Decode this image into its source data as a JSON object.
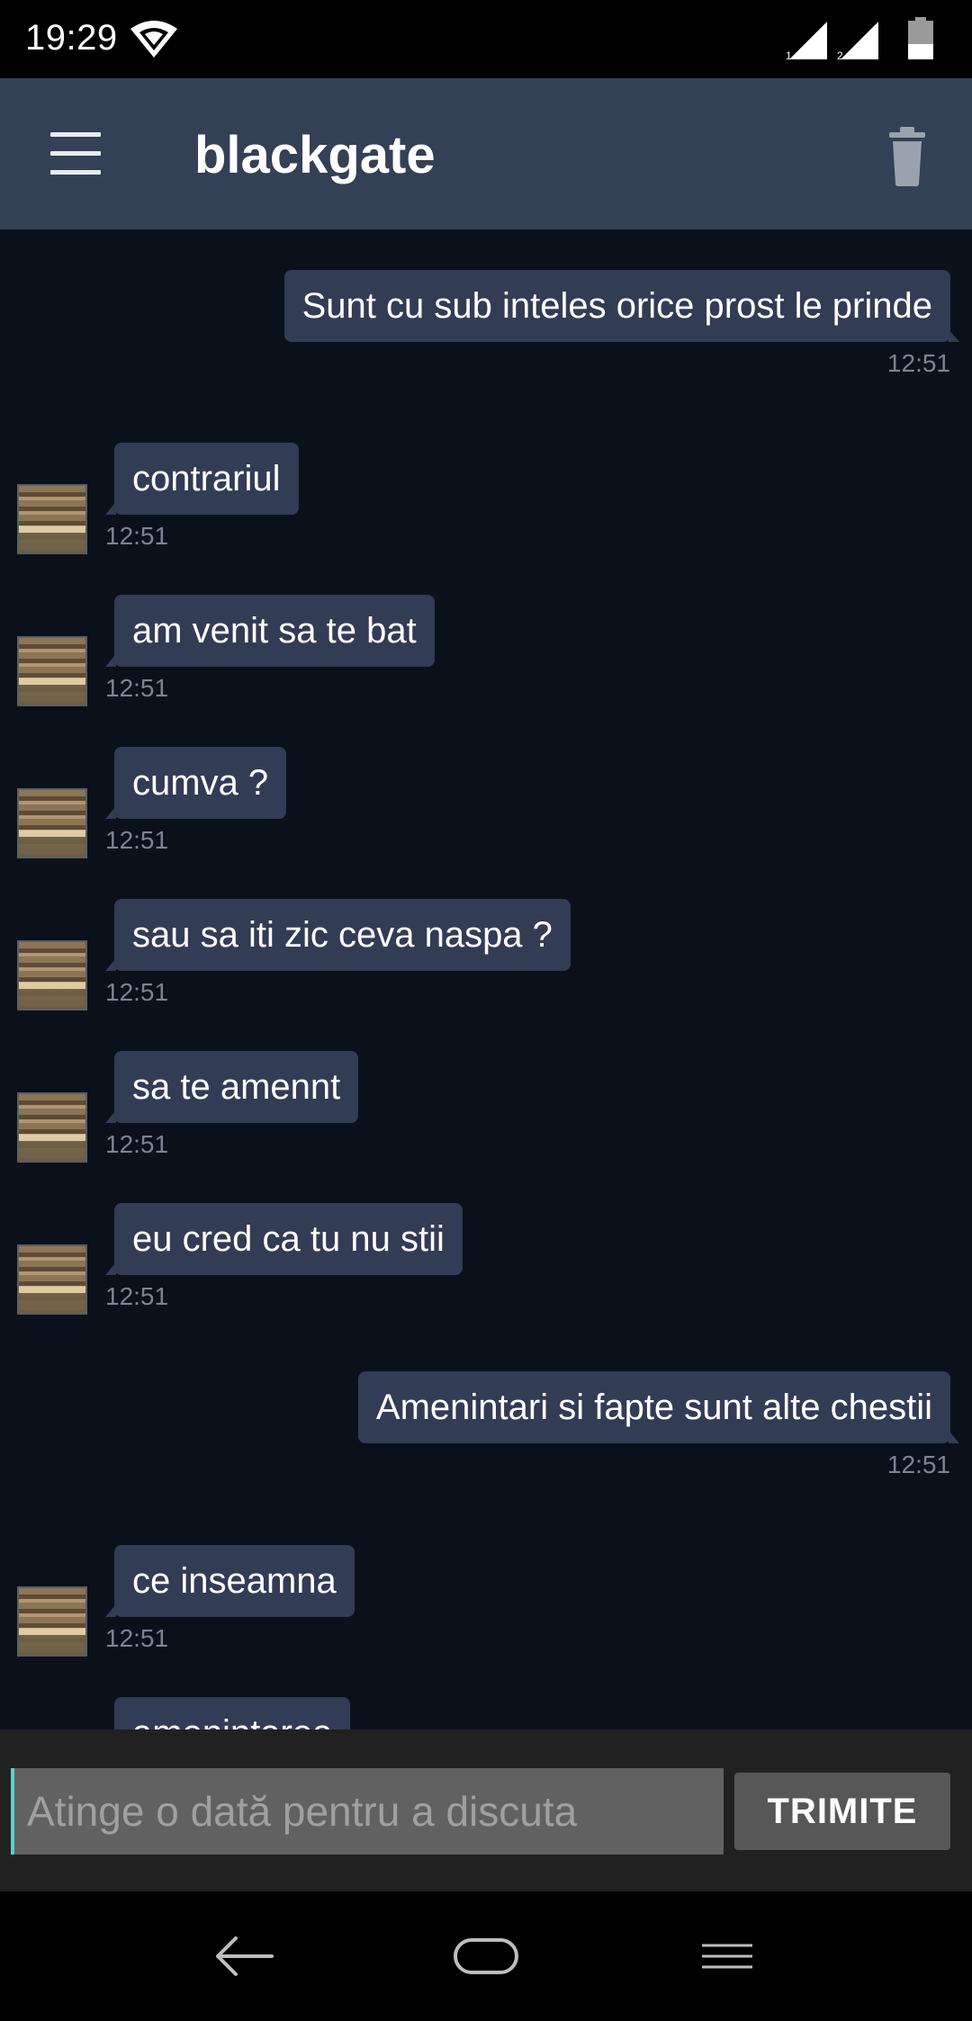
{
  "status_bar": {
    "time": "19:29",
    "icons": [
      "wifi-icon",
      "signal-sim1-icon",
      "signal-sim2-icon",
      "battery-icon"
    ],
    "sim1_label": "1",
    "sim2_label": "2"
  },
  "app_bar": {
    "title": "blackgate",
    "menu_icon": "menu-icon",
    "delete_icon": "trash-icon"
  },
  "messages": [
    {
      "direction": "out",
      "text": "Sunt cu sub inteles orice prost le prinde",
      "time": "12:51"
    },
    {
      "direction": "in",
      "text": "contrariul",
      "time": "12:51"
    },
    {
      "direction": "in",
      "text": "am venit sa te bat",
      "time": "12:51"
    },
    {
      "direction": "in",
      "text": "cumva ?",
      "time": "12:51"
    },
    {
      "direction": "in",
      "text": "sau sa iti zic ceva naspa ?",
      "time": "12:51"
    },
    {
      "direction": "in",
      "text": "sa te amennt",
      "time": "12:51"
    },
    {
      "direction": "in",
      "text": "eu cred ca tu nu stii",
      "time": "12:51"
    },
    {
      "direction": "out",
      "text": "Amenintari si fapte sunt alte chestii",
      "time": "12:51"
    },
    {
      "direction": "in",
      "text": "ce inseamna",
      "time": "12:51"
    },
    {
      "direction": "in",
      "text": "amenintarea",
      "time": ""
    }
  ],
  "composer": {
    "placeholder": "Atinge o dată pentru a discuta",
    "value": "",
    "send_label": "TRIMITE"
  },
  "nav_bar": {
    "icons": [
      "back-icon",
      "home-icon",
      "recents-icon"
    ]
  },
  "colors": {
    "background": "#0b111b",
    "app_bar": "#334055",
    "bubble": "#333c55",
    "timestamp": "#7c8493",
    "cursor": "#5ad1cf"
  }
}
